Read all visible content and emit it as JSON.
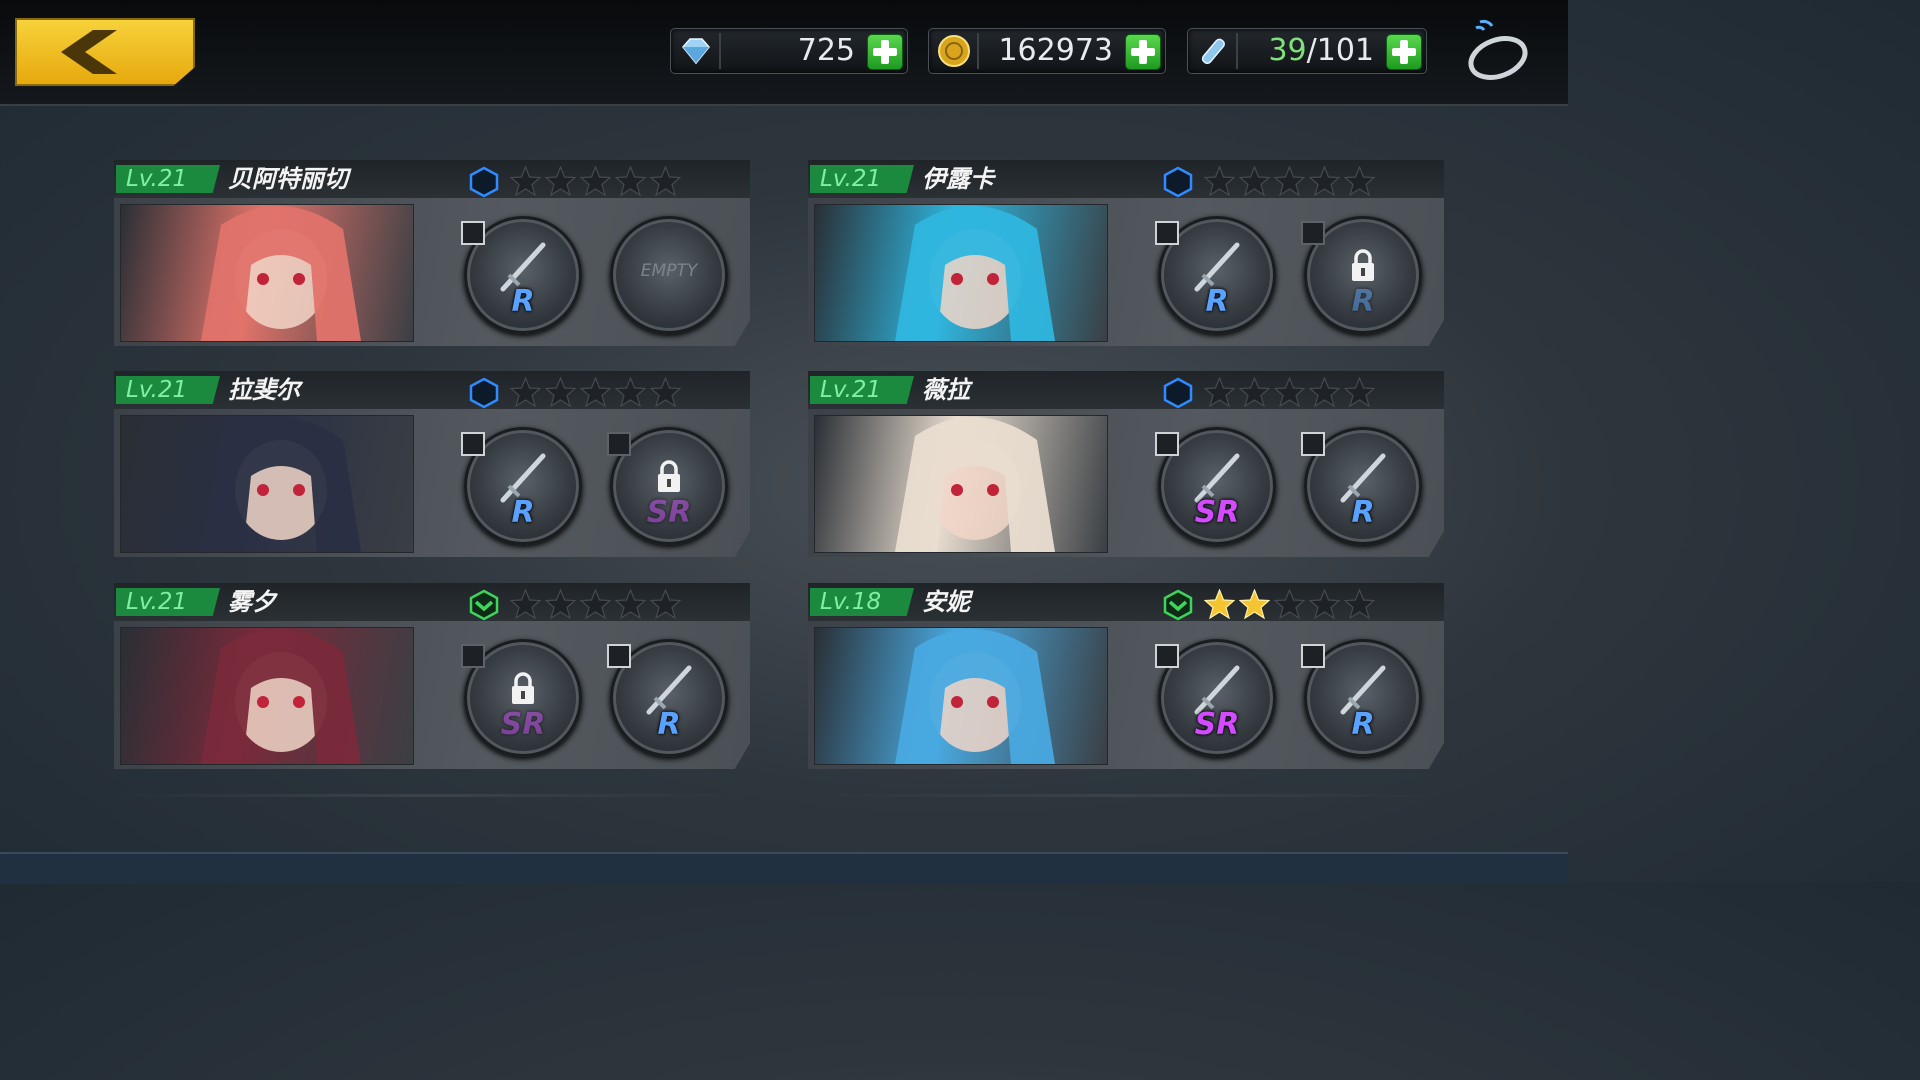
{
  "currency": {
    "diamonds": "725",
    "gold": "162973",
    "stamina_current": "39",
    "stamina_max": "/101"
  },
  "characters": [
    {
      "level": "Lv.21",
      "name": "贝阿特丽切",
      "rank": "blue",
      "stars": 0,
      "weapon1": {
        "rarity": "R",
        "locked": false,
        "empty": false
      },
      "weapon2": {
        "rarity": "",
        "locked": false,
        "empty": true,
        "empty_label": "EMPTY"
      }
    },
    {
      "level": "Lv.21",
      "name": "伊露卡",
      "rank": "blue",
      "stars": 0,
      "weapon1": {
        "rarity": "R",
        "locked": false,
        "empty": false
      },
      "weapon2": {
        "rarity": "R",
        "locked": true,
        "empty": false
      }
    },
    {
      "level": "Lv.21",
      "name": "拉斐尔",
      "rank": "blue",
      "stars": 0,
      "weapon1": {
        "rarity": "R",
        "locked": false,
        "empty": false
      },
      "weapon2": {
        "rarity": "SR",
        "locked": true,
        "empty": false
      }
    },
    {
      "level": "Lv.21",
      "name": "薇拉",
      "rank": "blue",
      "stars": 0,
      "weapon1": {
        "rarity": "SR",
        "locked": false,
        "empty": false
      },
      "weapon2": {
        "rarity": "R",
        "locked": false,
        "empty": false
      }
    },
    {
      "level": "Lv.21",
      "name": "雾夕",
      "rank": "green",
      "stars": 0,
      "weapon1": {
        "rarity": "SR",
        "locked": true,
        "empty": false
      },
      "weapon2": {
        "rarity": "R",
        "locked": false,
        "empty": false
      }
    },
    {
      "level": "Lv.18",
      "name": "安妮",
      "rank": "green",
      "stars": 2,
      "weapon1": {
        "rarity": "SR",
        "locked": false,
        "empty": false
      },
      "weapon2": {
        "rarity": "R",
        "locked": false,
        "empty": false
      }
    }
  ],
  "portrait_colors": [
    "#e0736a",
    "#2fb6df",
    "#2a2f45",
    "#e9ddd0",
    "#7a2a3a",
    "#49a9e0"
  ],
  "colors": {
    "accent_gold": "#f2c225",
    "level_green": "#1b8a3f",
    "rarity_r": "#5aa2ff",
    "rarity_sr": "#d24bff"
  }
}
